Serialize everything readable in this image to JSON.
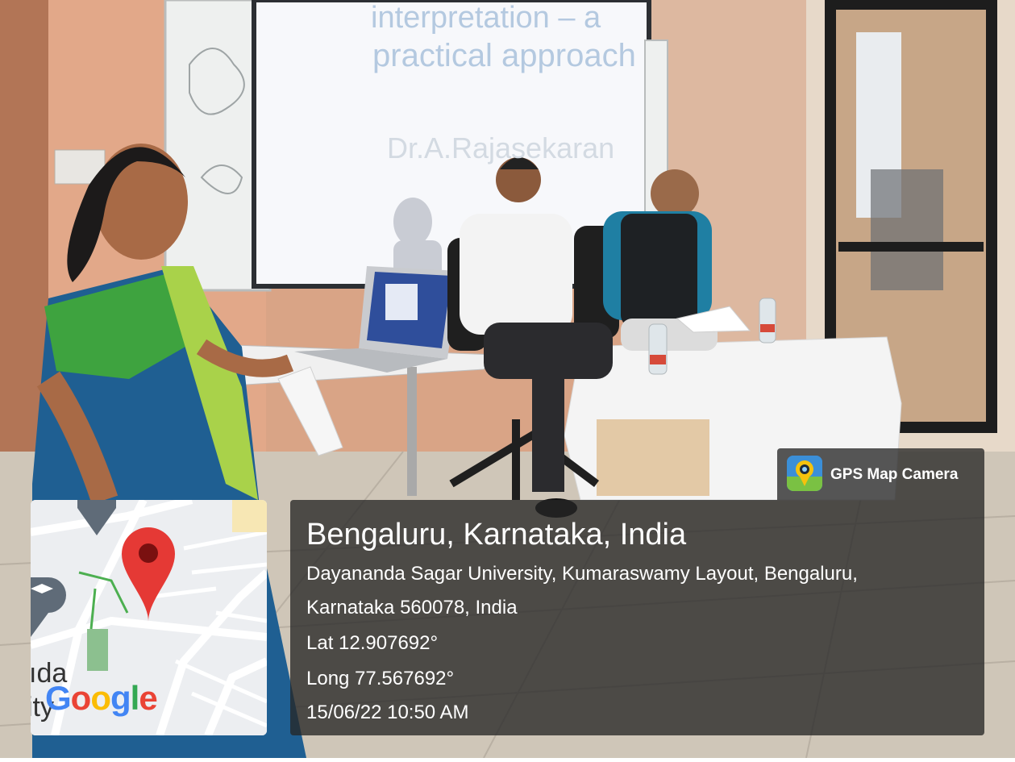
{
  "photo": {
    "projected_slide": {
      "line1": "interpretation – a",
      "line2": "practical approach",
      "presenter": "Dr.A.Rajasekaran"
    }
  },
  "overlay": {
    "app_name": "GPS Map Camera",
    "location_title": "Bengaluru, Karnataka, India",
    "address_line1": "Dayananda Sagar University, Kumaraswamy Layout, Bengaluru,",
    "address_line2": "Karnataka 560078, India",
    "latitude": "Lat 12.907692°",
    "longitude": "Long 77.567692°",
    "datetime": "15/06/22 10:50 AM"
  },
  "map": {
    "logo": {
      "g1": "G",
      "o1": "o",
      "o2": "o",
      "g2": "g",
      "l": "l",
      "e": "e"
    },
    "label_top": "ıda",
    "label_bottom": "sity",
    "colors": {
      "pin": "#e53935",
      "pin_dot": "#7a1010",
      "road": "#ffffff",
      "green": "#8cc08f",
      "poi": "#5f6b78"
    }
  }
}
